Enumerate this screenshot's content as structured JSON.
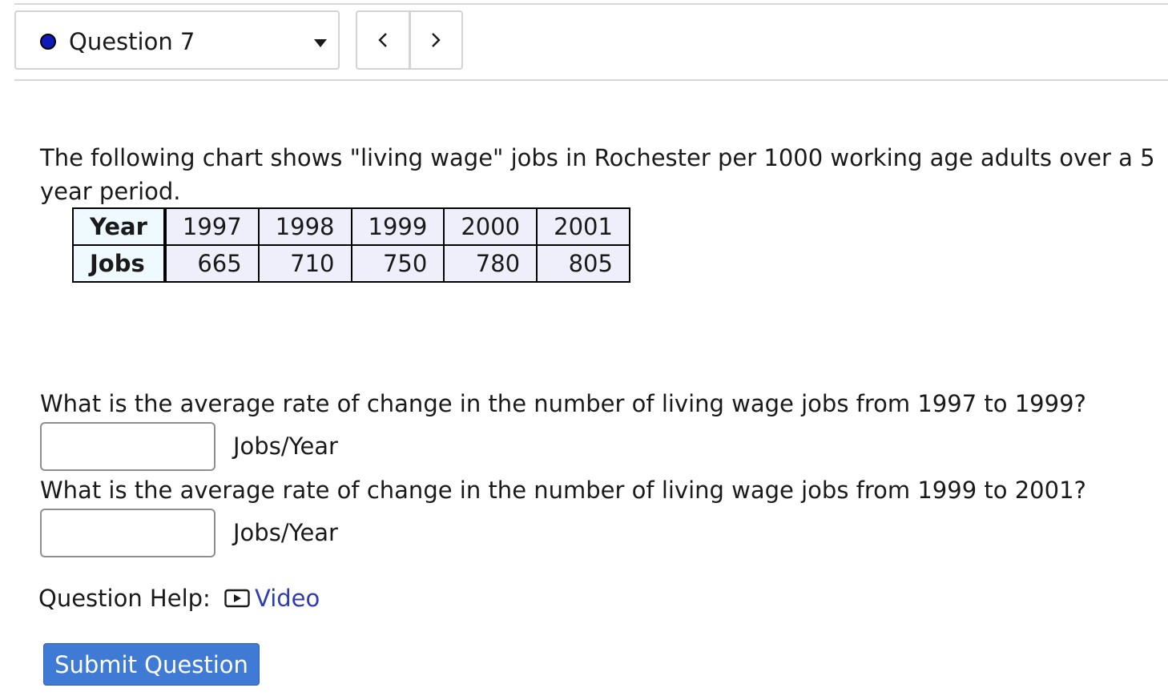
{
  "question_nav": {
    "selected_label": "Question 7",
    "status_color": "#0f1bb8",
    "prev_icon": "chevron-left-icon",
    "next_icon": "chevron-right-icon"
  },
  "intro_text": "The following chart shows \"living wage\" jobs in Rochester per 1000 working age adults over a 5 year period.",
  "table": {
    "row_headers": [
      "Year",
      "Jobs"
    ],
    "years": [
      "1997",
      "1998",
      "1999",
      "2000",
      "2001"
    ],
    "jobs": [
      "665",
      "710",
      "750",
      "780",
      "805"
    ]
  },
  "questions": [
    {
      "text": "What is the average rate of change in the number of living wage jobs from 1997 to 1999?",
      "answer_value": "",
      "unit": "Jobs/Year"
    },
    {
      "text": "What is the average rate of change in the number of living wage jobs from 1999 to 2001?",
      "answer_value": "",
      "unit": "Jobs/Year"
    }
  ],
  "help": {
    "label": "Question Help:",
    "video_label": "Video",
    "video_icon": "play-icon",
    "link_color": "#2f3bb1"
  },
  "submit_label": "Submit Question",
  "colors": {
    "submit_bg": "#3f7bd4",
    "year_header_bg": "#eefaff",
    "cell_bg": "#efeffb"
  }
}
